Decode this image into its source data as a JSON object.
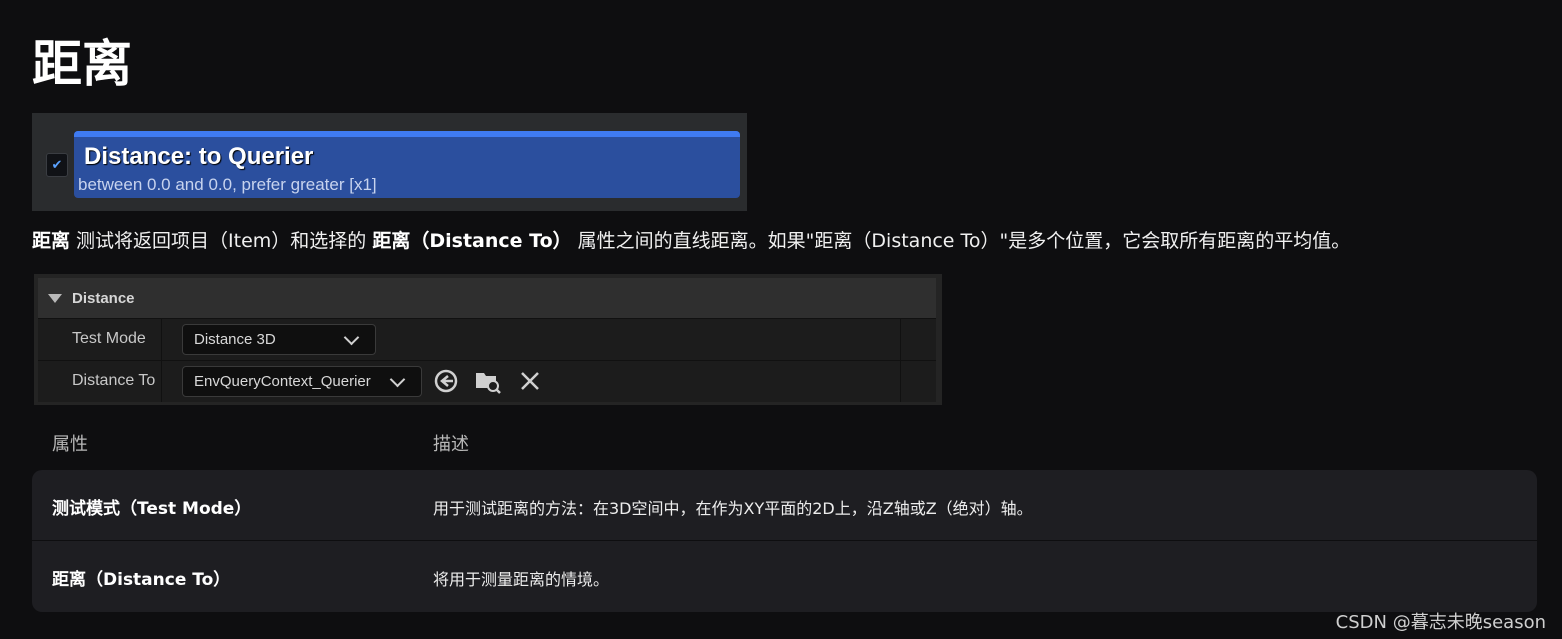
{
  "page": {
    "title": "距离"
  },
  "node": {
    "checked": true,
    "title": "Distance: to Querier",
    "subtitle": "between 0.0 and 0.0, prefer greater [x1]",
    "colors": {
      "header": "#3f7bf2",
      "body": "#2b4f9e"
    }
  },
  "description": {
    "part1_bold": "距离",
    "part2": " 测试将返回项目（Item）和选择的 ",
    "part3_bold": "距离（Distance To）",
    "part4": " 属性之间的直线距离。如果\"距离（Distance To）\"是多个位置，它会取所有距离的平均值。"
  },
  "details_panel": {
    "section_label": "Distance",
    "rows": [
      {
        "label": "Test Mode",
        "value": "Distance 3D"
      },
      {
        "label": "Distance To",
        "value": "EnvQueryContext_Querier"
      }
    ],
    "icons": [
      "arrow-left-circle-icon",
      "folder-search-icon",
      "close-icon"
    ]
  },
  "table": {
    "headers": [
      "属性",
      "描述"
    ],
    "rows": [
      {
        "property": "测试模式（Test Mode）",
        "description": "用于测试距离的方法：在3D空间中，在作为XY平面的2D上，沿Z轴或Z（绝对）轴。"
      },
      {
        "property": "距离（Distance To）",
        "description": "将用于测量距离的情境。"
      }
    ]
  },
  "watermark": "CSDN @暮志未晚season"
}
